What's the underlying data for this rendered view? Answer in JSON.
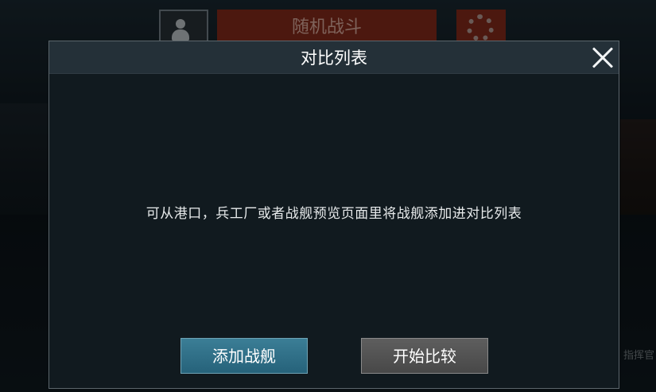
{
  "background": {
    "top_battle_label": "随机战斗",
    "bottom_right_label": "指挥官"
  },
  "modal": {
    "title": "对比列表",
    "message": "可从港口，兵工厂或者战舰预览页面里将战舰添加进对比列表",
    "buttons": {
      "add_label": "添加战舰",
      "compare_label": "开始比较"
    }
  }
}
